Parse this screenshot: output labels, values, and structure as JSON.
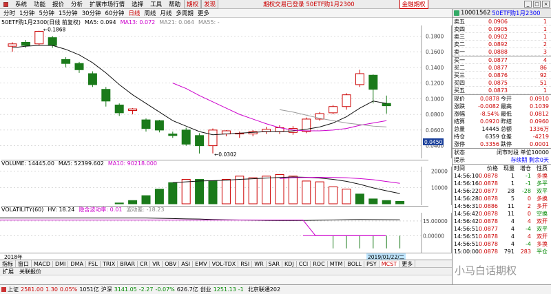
{
  "menu": {
    "items": [
      "系统",
      "功能",
      "报价",
      "分析",
      "扩展市场行情",
      "选择",
      "工具",
      "帮助"
    ],
    "tab_qihuo": "期权",
    "tab_fa": "发现",
    "center_title": "期权交易已登录  50ETF购1月2300",
    "brand": "金融期权"
  },
  "periods": {
    "items": [
      "分时",
      "1分钟",
      "5分钟",
      "15分钟",
      "30分钟",
      "60分钟",
      "日线",
      "周线",
      "月线",
      "多周期",
      "更多"
    ],
    "active_index": 6
  },
  "kline_info": {
    "title": "50ETF购1月2300(日线 前复权)",
    "ma5": "MA5: 0.094",
    "ma13": "MA13: 0.072",
    "ma21": "MA21: 0.064",
    "ma55": "MA55: -"
  },
  "kline_axis": [
    "0.1800",
    "0.1600",
    "0.1400",
    "0.1200",
    "0.1000",
    "0.0800",
    "0.0600",
    "0.0400"
  ],
  "kline_axis_values": [
    0.18,
    0.16,
    0.14,
    0.12,
    0.1,
    0.08,
    0.06,
    0.04
  ],
  "current_price_tag": "0.0450",
  "high_marker": "0.1868",
  "low_marker": "0.0302",
  "chart_data": {
    "type": "candlestick",
    "candles": [
      {
        "o": 0.167,
        "c": 0.17,
        "h": 0.172,
        "l": 0.16
      },
      {
        "o": 0.172,
        "c": 0.168,
        "h": 0.175,
        "l": 0.165
      },
      {
        "o": 0.17,
        "c": 0.186,
        "h": 0.1868,
        "l": 0.168
      },
      {
        "o": 0.178,
        "c": 0.168,
        "h": 0.18,
        "l": 0.165
      },
      {
        "o": 0.15,
        "c": 0.145,
        "h": 0.153,
        "l": 0.14
      },
      {
        "o": 0.145,
        "c": 0.137,
        "h": 0.147,
        "l": 0.133
      },
      {
        "o": 0.132,
        "c": 0.118,
        "h": 0.135,
        "l": 0.115
      },
      {
        "o": 0.112,
        "c": 0.097,
        "h": 0.115,
        "l": 0.09
      },
      {
        "o": 0.092,
        "c": 0.082,
        "h": 0.094,
        "l": 0.078
      },
      {
        "o": 0.085,
        "c": 0.087,
        "h": 0.088,
        "l": 0.08
      },
      {
        "o": 0.073,
        "c": 0.062,
        "h": 0.075,
        "l": 0.058
      },
      {
        "o": 0.072,
        "c": 0.06,
        "h": 0.073,
        "l": 0.057
      },
      {
        "o": 0.055,
        "c": 0.053,
        "h": 0.058,
        "l": 0.05
      },
      {
        "o": 0.06,
        "c": 0.042,
        "h": 0.063,
        "l": 0.04
      },
      {
        "o": 0.053,
        "c": 0.04,
        "h": 0.056,
        "l": 0.03
      },
      {
        "o": 0.04,
        "c": 0.06,
        "h": 0.062,
        "l": 0.0302
      },
      {
        "o": 0.055,
        "c": 0.059,
        "h": 0.06,
        "l": 0.052
      },
      {
        "o": 0.055,
        "c": 0.056,
        "h": 0.058,
        "l": 0.05
      },
      {
        "o": 0.055,
        "c": 0.058,
        "h": 0.06,
        "l": 0.052
      },
      {
        "o": 0.058,
        "c": 0.061,
        "h": 0.064,
        "l": 0.055
      },
      {
        "o": 0.058,
        "c": 0.063,
        "h": 0.066,
        "l": 0.055
      },
      {
        "o": 0.057,
        "c": 0.062,
        "h": 0.065,
        "l": 0.054
      },
      {
        "o": 0.058,
        "c": 0.074,
        "h": 0.076,
        "l": 0.056
      },
      {
        "o": 0.074,
        "c": 0.081,
        "h": 0.083,
        "l": 0.072
      },
      {
        "o": 0.082,
        "c": 0.09,
        "h": 0.092,
        "l": 0.08
      },
      {
        "o": 0.09,
        "c": 0.105,
        "h": 0.107,
        "l": 0.086
      },
      {
        "o": 0.118,
        "c": 0.132,
        "h": 0.137,
        "l": 0.115
      },
      {
        "o": 0.13,
        "c": 0.112,
        "h": 0.131,
        "l": 0.094
      },
      {
        "o": 0.094,
        "c": 0.091,
        "h": 0.104,
        "l": 0.081
      }
    ],
    "ma5": [
      0.165,
      0.167,
      0.168,
      0.168,
      0.163,
      0.156,
      0.146,
      0.133,
      0.118,
      0.105,
      0.094,
      0.083,
      0.072,
      0.065,
      0.058,
      0.054,
      0.055,
      0.056,
      0.057,
      0.058,
      0.058,
      0.059,
      0.061,
      0.064,
      0.069,
      0.077,
      0.088,
      0.097,
      0.094
    ],
    "ma13": [
      null,
      null,
      null,
      null,
      null,
      null,
      null,
      null,
      null,
      null,
      null,
      null,
      0.12,
      0.113,
      0.104,
      0.096,
      0.088,
      0.08,
      0.074,
      0.068,
      0.063,
      0.06,
      0.059,
      0.059,
      0.06,
      0.062,
      0.066,
      0.069,
      0.072
    ],
    "ma21": [
      null,
      null,
      null,
      null,
      null,
      null,
      null,
      null,
      null,
      null,
      null,
      null,
      null,
      null,
      null,
      null,
      null,
      null,
      null,
      null,
      0.086,
      0.083,
      0.079,
      0.075,
      0.072,
      0.069,
      0.067,
      0.065,
      0.064
    ]
  },
  "volume": {
    "title": "VOLUME: 14445.00",
    "ma5": "MA5: 52399.602",
    "ma10": "MA10: 90218.000",
    "axis": [
      "20000",
      "10000"
    ],
    "axis_values": [
      20000,
      10000
    ],
    "bars": [
      0,
      0,
      0,
      0,
      0,
      0,
      0,
      0,
      500,
      2000,
      5000,
      9000,
      13000,
      15000,
      15000,
      14000,
      15000,
      17000,
      16000,
      17000,
      18000,
      17000,
      14000,
      13500,
      10500,
      9000,
      6000,
      3000,
      2000,
      1500
    ],
    "up": [
      false,
      false,
      false,
      false,
      false,
      false,
      false,
      false,
      false,
      false,
      false,
      false,
      false,
      true,
      false,
      false,
      true,
      true,
      true,
      true,
      true,
      true,
      true,
      true,
      true,
      true,
      false,
      false,
      false,
      false
    ],
    "ma5_line": [
      null,
      null,
      null,
      null,
      null,
      null,
      null,
      null,
      null,
      null,
      null,
      null,
      13000,
      13500,
      14000,
      14200,
      14500,
      15000,
      15400,
      15800,
      16200,
      16500,
      16300,
      15800,
      15000,
      13800,
      12000,
      9800,
      8000,
      6300
    ],
    "ma10_line": [
      null,
      null,
      null,
      null,
      null,
      null,
      null,
      null,
      null,
      null,
      null,
      null,
      null,
      null,
      null,
      null,
      null,
      null,
      null,
      null,
      15500,
      16000,
      16200,
      16300,
      16200,
      16000,
      15500,
      14800,
      13700,
      12600
    ]
  },
  "volatility": {
    "title": "VOLATILITY(60)",
    "hv": "HV: 18.24",
    "implied": "隐含波动率: 0.01",
    "ivlabel": "波动差: -18.23",
    "axis": [
      "15.00000",
      "0.00000"
    ],
    "axis_values": [
      15,
      0
    ],
    "hv_line": [
      18,
      18,
      18,
      18,
      18,
      18,
      18,
      18,
      18,
      18,
      18,
      17.8,
      17.5,
      17.2,
      17,
      16.5,
      16.2,
      16,
      15.8,
      15.6,
      15.5,
      15.5,
      15.6,
      15.8,
      16,
      16.3,
      16.5,
      16.4,
      16.3,
      16.2
    ],
    "diff_bars": [
      0,
      0,
      0,
      0,
      0,
      0,
      0,
      0,
      0,
      0,
      0,
      0,
      0,
      0,
      0,
      0,
      0,
      0,
      0,
      0,
      0,
      0,
      0,
      0,
      -13,
      -13,
      -13,
      -13,
      -13,
      -13
    ]
  },
  "date_label_left": "2018年",
  "date_label_right": "2019/01/22/二",
  "indicator_tabs": [
    "指标",
    "窗口",
    "MACD",
    "DMI",
    "DMA",
    "FSL",
    "TRIX",
    "BRAR",
    "CR",
    "VR",
    "OBV",
    "ASI",
    "EMV",
    "VOL-TDX",
    "RSI",
    "WR",
    "SAR",
    "KDJ",
    "CCI",
    "ROC",
    "MTM",
    "BOLL",
    "PSY",
    "MCST",
    "更多"
  ],
  "sub_tabs": [
    "扩展",
    "关联报价"
  ],
  "quote": {
    "code": "10001562",
    "name": "50ETF购1月2300",
    "asks": [
      {
        "label": "卖五",
        "price": "0.0906",
        "vol": "1"
      },
      {
        "label": "卖四",
        "price": "0.0905",
        "vol": "1"
      },
      {
        "label": "卖三",
        "price": "0.0902",
        "vol": "1"
      },
      {
        "label": "卖二",
        "price": "0.0892",
        "vol": "2"
      },
      {
        "label": "卖一",
        "price": "0.0888",
        "vol": "3"
      }
    ],
    "bids": [
      {
        "label": "买一",
        "price": "0.0877",
        "vol": "4"
      },
      {
        "label": "买二",
        "price": "0.0877",
        "vol": "86"
      },
      {
        "label": "买三",
        "price": "0.0876",
        "vol": "92"
      },
      {
        "label": "买四",
        "price": "0.0875",
        "vol": "51"
      },
      {
        "label": "买五",
        "price": "0.0873",
        "vol": "1"
      }
    ],
    "stats": [
      {
        "a": "现价",
        "b": "0.0878",
        "c": "今开",
        "d": "0.0910"
      },
      {
        "a": "涨跌",
        "b": "-0.0082",
        "c": "最高",
        "d": "0.1039"
      },
      {
        "a": "涨幅",
        "b": "-8.54%",
        "c": "最低",
        "d": "0.0812"
      },
      {
        "a": "结算",
        "b": "0.0920",
        "c": "昨结",
        "d": "0.0960"
      },
      {
        "a": "总量",
        "b": "14445",
        "c": "总额",
        "d": "1336万"
      },
      {
        "a": "持仓",
        "b": "6359",
        "c": "仓差",
        "d": "-4219"
      },
      {
        "a": "涨停",
        "b": "0.3356",
        "c": "跌停",
        "d": "0.0001"
      }
    ],
    "status_label": "状态",
    "status_value": "闭市时段 单位10000",
    "tip_label": "提示",
    "tip_value": "存续期 剩余0天",
    "ticks_header": [
      "时间",
      "价格",
      "现量",
      "增仓",
      "性质"
    ],
    "ticks": [
      {
        "t": "14:56:10",
        "p": "0.0878",
        "v": "1",
        "z": "-1",
        "n": "多换"
      },
      {
        "t": "14:56:16",
        "p": "0.0878",
        "v": "1",
        "z": "-1",
        "n": "多平"
      },
      {
        "t": "14:56:22",
        "p": "0.0877",
        "v": "28",
        "z": "-28",
        "n": "双平"
      },
      {
        "t": "14:56:28",
        "p": "0.0878",
        "v": "5",
        "z": "0",
        "n": "多换"
      },
      {
        "t": "14:56:31",
        "p": "0.0886",
        "v": "11",
        "z": "2",
        "n": "多开"
      },
      {
        "t": "14:56:42",
        "p": "0.0878",
        "v": "11",
        "z": "0",
        "n": "空换"
      },
      {
        "t": "14:56:42",
        "p": "0.0878",
        "v": "4",
        "z": "4",
        "n": "双开"
      },
      {
        "t": "14:56:51",
        "p": "0.0877",
        "v": "4",
        "z": "-4",
        "n": "双平"
      },
      {
        "t": "14:56:51",
        "p": "0.0878",
        "v": "4",
        "z": "4",
        "n": "双开"
      },
      {
        "t": "14:56:51",
        "p": "0.0878",
        "v": "4",
        "z": "-4",
        "n": "多换"
      },
      {
        "t": "15:00:00",
        "p": "0.0878",
        "v": "791",
        "z": "283",
        "n": "平仓"
      }
    ]
  },
  "statusbar": {
    "items": [
      {
        "name": "上证",
        "val": "2581.00",
        "chg": "1.30",
        "pct": "0.05%",
        "amt": "1051亿"
      },
      {
        "name": "沪深",
        "val": "3141.05",
        "chg": "-2.27",
        "pct": "-0.07%",
        "amt": "626.7亿"
      },
      {
        "name": "创业",
        "val": "1251.13",
        "chg": "-1",
        "pct": ""
      }
    ],
    "broker": "北京联通202"
  },
  "watermark": "小马白话期权"
}
